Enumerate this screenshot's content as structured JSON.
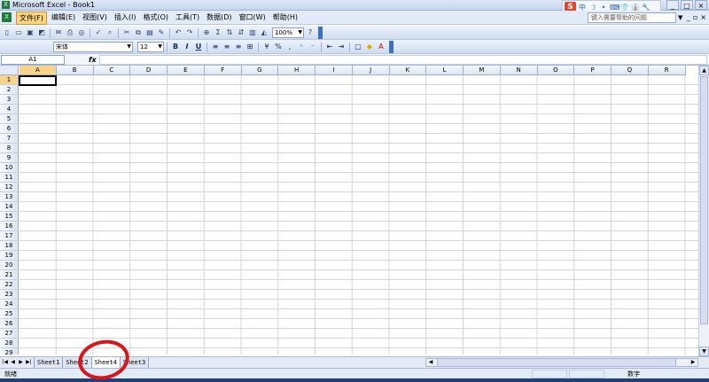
{
  "window": {
    "title": "Microsoft Excel - Book1"
  },
  "ime": {
    "badge": "S",
    "mode": "中",
    "buttons": [
      "中",
      "☽",
      "•",
      "⌨",
      "👕",
      "👔",
      "🔧"
    ]
  },
  "window_controls": [
    "_",
    "□",
    "×"
  ],
  "menu": {
    "items": [
      "文件(F)",
      "编辑(E)",
      "视图(V)",
      "插入(I)",
      "格式(O)",
      "工具(T)",
      "数据(D)",
      "窗口(W)",
      "帮助(H)"
    ],
    "active_index": 0,
    "help_placeholder": "键入需要帮助的问题"
  },
  "toolbar": {
    "zoom": "100%",
    "autosum": "Σ",
    "font_name": "宋体",
    "font_size": "12",
    "bold": "B",
    "italic": "I",
    "underline": "U",
    "percent": "%"
  },
  "formula_bar": {
    "cell_ref": "A1",
    "fx": "fx",
    "value": ""
  },
  "grid": {
    "columns": [
      "A",
      "B",
      "C",
      "D",
      "E",
      "F",
      "G",
      "H",
      "I",
      "J",
      "K",
      "L",
      "M",
      "N",
      "O",
      "P",
      "Q",
      "R"
    ],
    "rows": [
      "1",
      "2",
      "3",
      "4",
      "5",
      "6",
      "7",
      "8",
      "9",
      "10",
      "11",
      "12",
      "13",
      "14",
      "15",
      "16",
      "17",
      "18",
      "19",
      "20",
      "21",
      "22",
      "23",
      "24",
      "25",
      "26",
      "27",
      "28",
      "29"
    ],
    "selected_column": "A",
    "selected_row": "1"
  },
  "sheets": {
    "tabs": [
      "Sheet1",
      "Sheet2",
      "Sheet4",
      "Sheet3"
    ],
    "active_index": 2
  },
  "status": {
    "left": "就绪",
    "num": "数字"
  },
  "colors": {
    "annotation": "#d8151b",
    "selection": "#f8d48a",
    "active_menu": "#ffd580"
  }
}
